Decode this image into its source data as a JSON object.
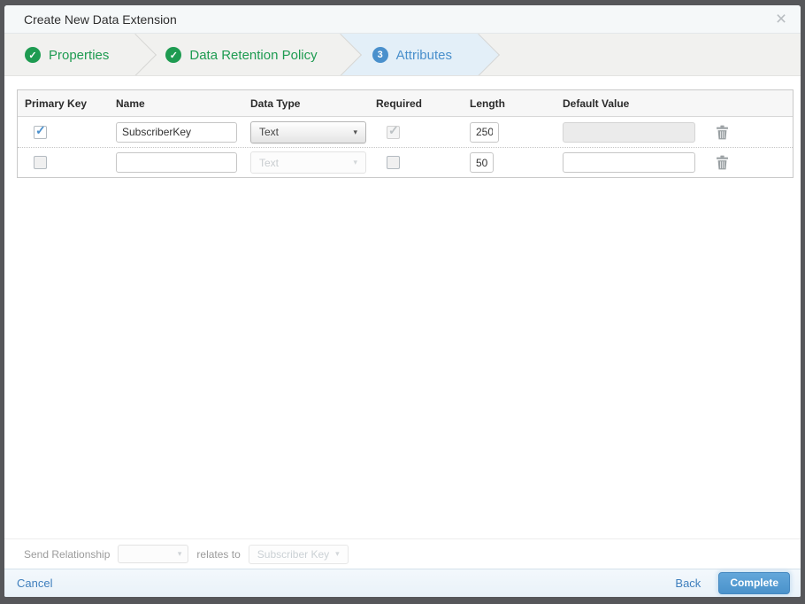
{
  "modal": {
    "title": "Create New Data Extension"
  },
  "icons": {
    "close": "×",
    "check": "✓",
    "caret": "▾",
    "trash": "trash-can"
  },
  "wizard": {
    "steps": [
      {
        "label": "Properties",
        "status": "complete"
      },
      {
        "label": "Data Retention Policy",
        "status": "complete"
      },
      {
        "label": "Attributes",
        "status": "active",
        "number": "3"
      }
    ]
  },
  "attributes_table": {
    "headers": [
      "Primary Key",
      "Name",
      "Data Type",
      "Required",
      "Length",
      "Default Value"
    ],
    "rows": [
      {
        "primary_key": true,
        "name": "SubscriberKey",
        "data_type": "Text",
        "data_type_disabled": false,
        "required": true,
        "required_disabled": true,
        "length": "250",
        "default_value": "",
        "default_value_disabled": true
      },
      {
        "primary_key": false,
        "name": "",
        "data_type": "Text",
        "data_type_disabled": true,
        "required": false,
        "required_disabled": false,
        "length": "50",
        "default_value": "",
        "default_value_disabled": false
      }
    ]
  },
  "send_relationship": {
    "label": "Send Relationship",
    "select_value": "",
    "relates_to": "relates to",
    "target_field": "Subscriber Key"
  },
  "footer": {
    "cancel": "Cancel",
    "back": "Back",
    "complete": "Complete"
  },
  "colors": {
    "accent_green": "#1e9b51",
    "accent_blue": "#4a90cc",
    "active_step_bg": "#e3eff8",
    "button_blue": "#4a92cb",
    "frame": "#56575a"
  }
}
